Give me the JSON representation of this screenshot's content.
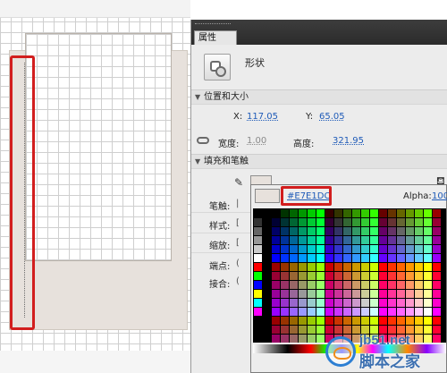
{
  "panel": {
    "tab_title": "属性",
    "shape_type": "形状"
  },
  "position_size": {
    "section_title": "位置和大小",
    "x_label": "X:",
    "x_value": "117.05",
    "y_label": "Y:",
    "y_value": "65.05",
    "width_label": "宽度:",
    "width_value": "1.00",
    "height_label": "高度:",
    "height_value": "321.95"
  },
  "fill_stroke": {
    "section_title": "填充和笔触",
    "stroke_label": "笔触:",
    "style_label": "样式:",
    "scale_label": "缩放:",
    "cap_label": "端点:",
    "join_label": "接合:",
    "stroke_color": "#E7E1DC"
  },
  "color_picker": {
    "hex_value": "#E7E1DC",
    "alpha_label": "Alpha:",
    "alpha_value": "100"
  },
  "watermark": {
    "site": "jb51.net",
    "name": "脚本之家"
  },
  "colors": {
    "shape_fill": "#e7e1dc",
    "highlight": "#d21e1e",
    "link_blue": "#1f5bb8"
  },
  "icons": [
    "link-icon",
    "pencil-icon",
    "paint-bucket-icon",
    "shape-thumbnail-icon"
  ]
}
